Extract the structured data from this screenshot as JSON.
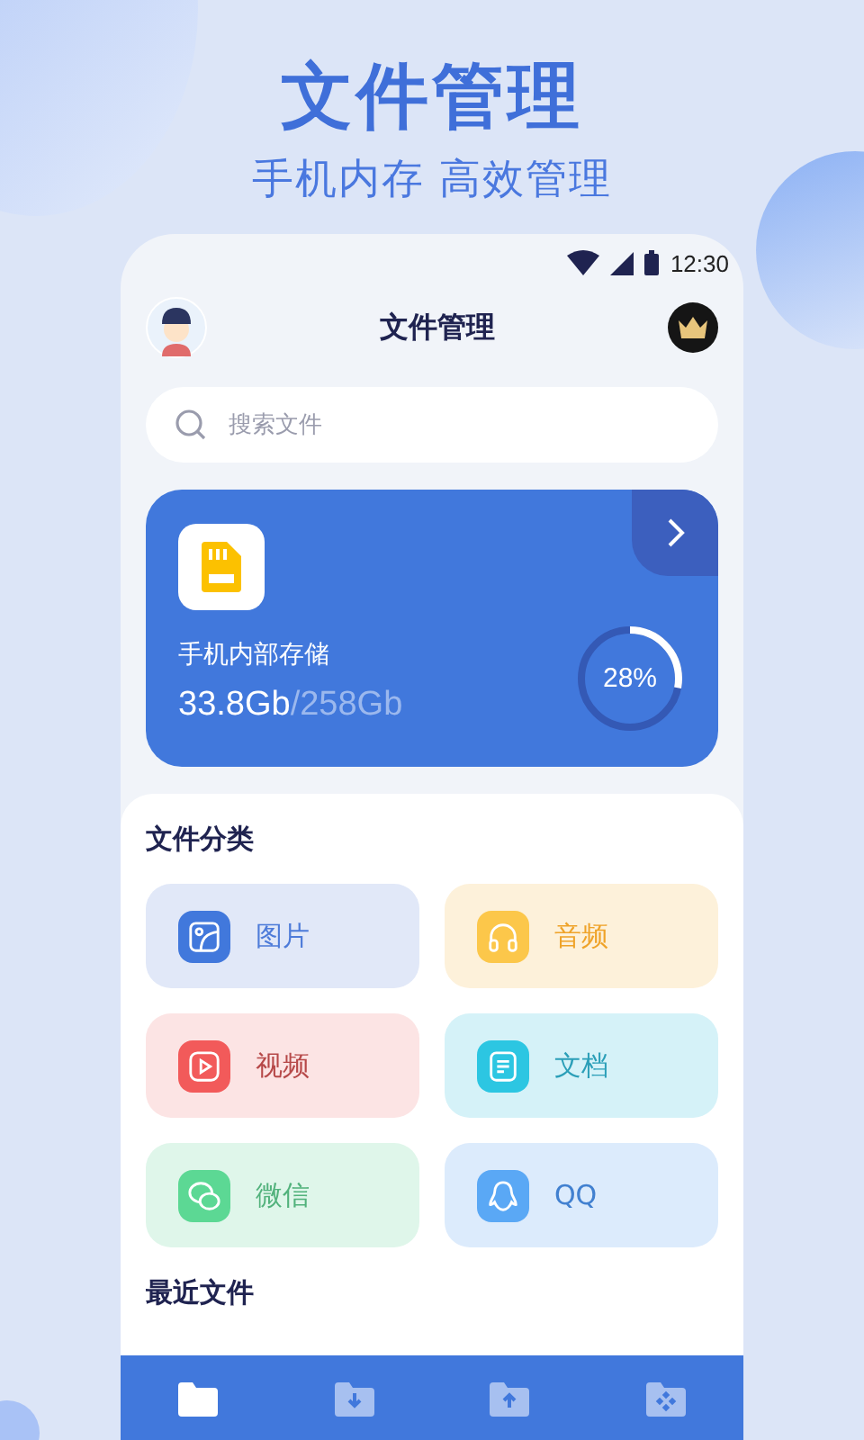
{
  "promo": {
    "title": "文件管理",
    "subtitle": "手机内存 高效管理"
  },
  "status_bar": {
    "time": "12:30"
  },
  "header": {
    "title": "文件管理"
  },
  "search": {
    "placeholder": "搜索文件"
  },
  "storage": {
    "name": "手机内部存储",
    "used": "33.8Gb",
    "separator": "/",
    "total": "258Gb",
    "percent": "28%"
  },
  "categories_title": "文件分类",
  "categories": [
    {
      "kind": "image",
      "label": "图片",
      "color": "#4178dc"
    },
    {
      "kind": "audio",
      "label": "音频",
      "color": "#fcc74a"
    },
    {
      "kind": "video",
      "label": "视频",
      "color": "#f25a5a"
    },
    {
      "kind": "doc",
      "label": "文档",
      "color": "#2cc6e2"
    },
    {
      "kind": "wechat",
      "label": "微信",
      "color": "#5cd894"
    },
    {
      "kind": "qq",
      "label": "QQ",
      "color": "#5aa8f5"
    }
  ],
  "recent_title": "最近文件",
  "nav": [
    {
      "kind": "folder",
      "selected": true
    },
    {
      "kind": "download",
      "selected": false
    },
    {
      "kind": "upload",
      "selected": false
    },
    {
      "kind": "apps",
      "selected": false
    }
  ]
}
